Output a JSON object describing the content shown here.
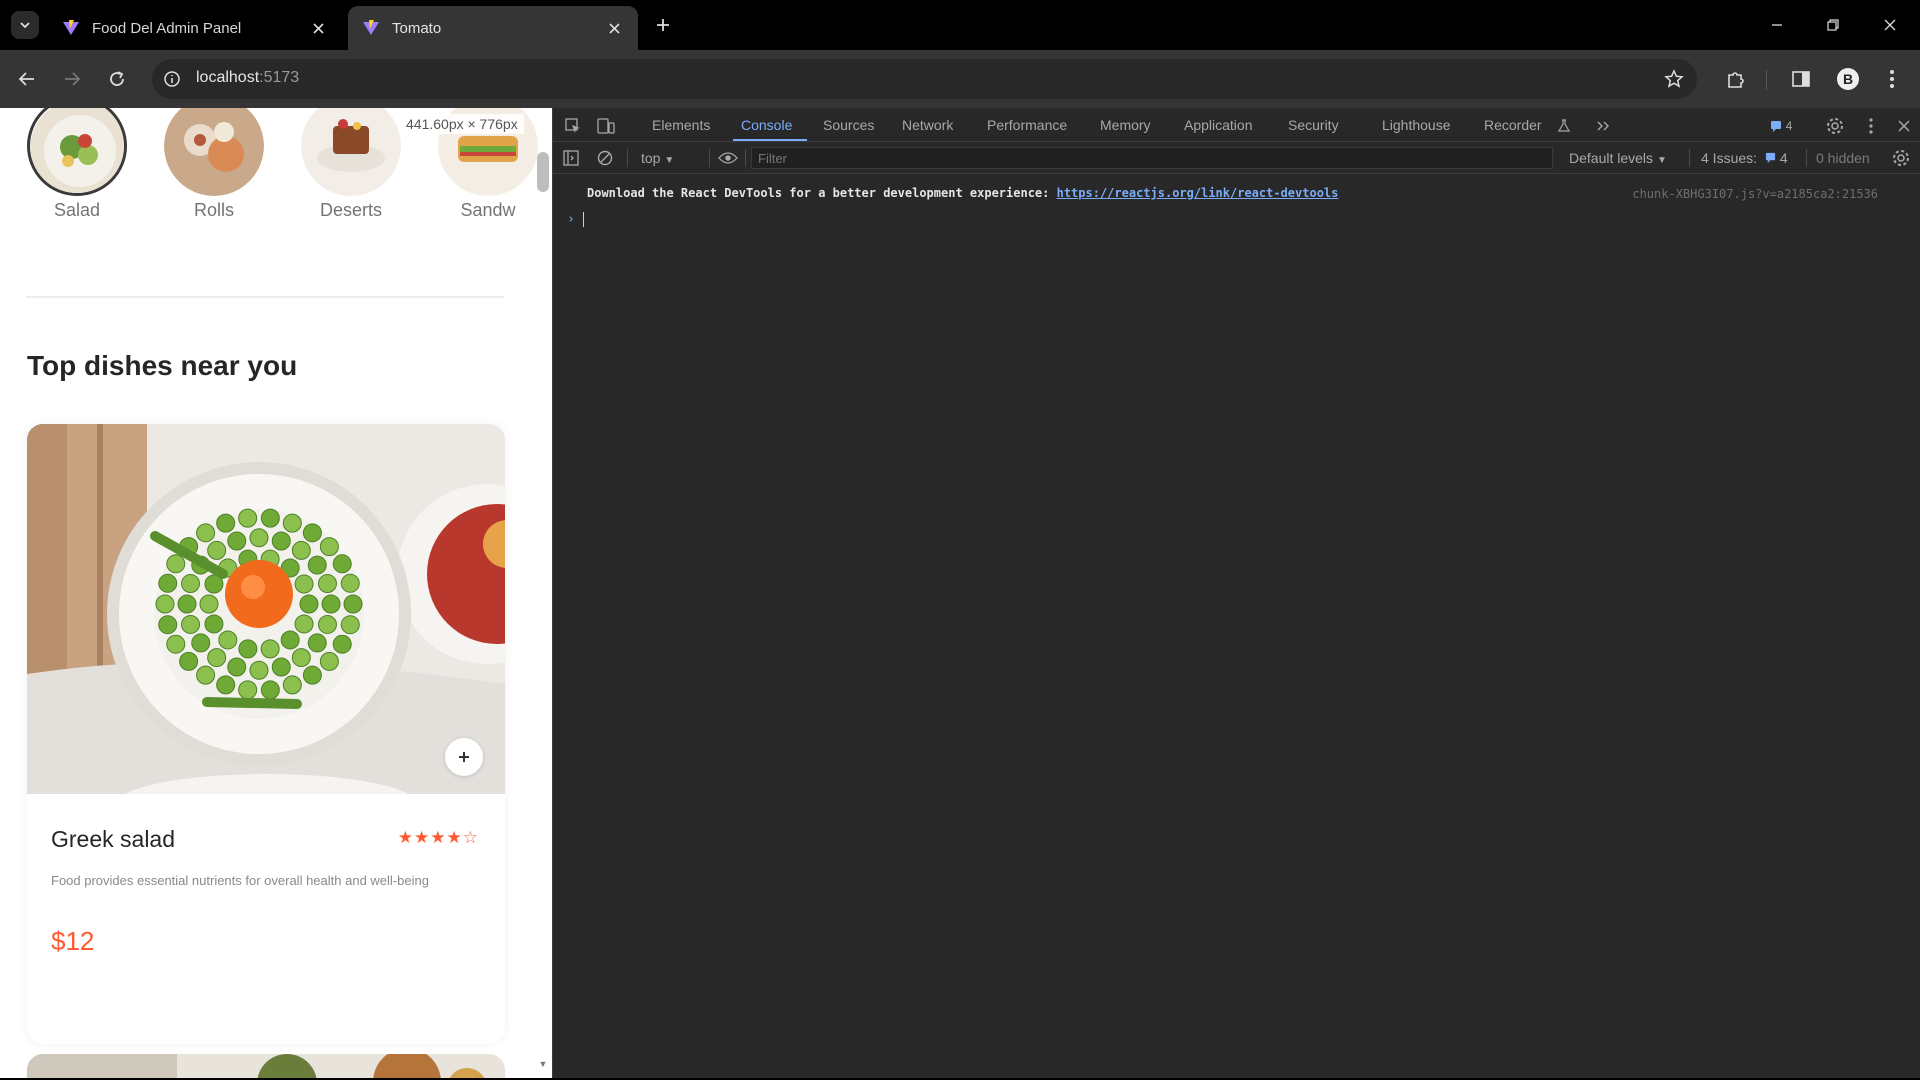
{
  "browser": {
    "tabs": [
      {
        "title": "Food Del Admin Panel",
        "active": false
      },
      {
        "title": "Tomato",
        "active": true
      }
    ],
    "url_host": "localhost",
    "url_port": ":5173",
    "accent_color": "#7cacf8"
  },
  "page": {
    "categories": [
      {
        "label": "Salad",
        "icon": "salad-image"
      },
      {
        "label": "Rolls",
        "icon": "rolls-image"
      },
      {
        "label": "Deserts",
        "icon": "deserts-image"
      },
      {
        "label": "Sandw",
        "icon": "sandwich-image"
      }
    ],
    "viewport_size": "441.60px × 776px",
    "section_title": "Top dishes near you",
    "dish": {
      "name": "Greek salad",
      "rating": 4,
      "rating_max": 5,
      "stars_text": "★★★★☆",
      "description": "Food provides essential nutrients for overall health and well-being",
      "price": "$12"
    },
    "brand_color": "#ff5a32"
  },
  "devtools": {
    "tabs": [
      "Elements",
      "Console",
      "Sources",
      "Network",
      "Performance",
      "Memory",
      "Application",
      "Security",
      "Lighthouse",
      "Recorder"
    ],
    "active_tab": "Console",
    "message_count": "4",
    "context": "top",
    "filter_placeholder": "Filter",
    "levels": "Default levels",
    "issues": "4 Issues:",
    "issues_count": "4",
    "hidden": "0 hidden",
    "message_text": "Download the React DevTools for a better development experience: ",
    "message_link": "https://reactjs.org/link/react-devtools",
    "message_source": "chunk-XBHG3I07.js?v=a2185ca2:21536"
  }
}
